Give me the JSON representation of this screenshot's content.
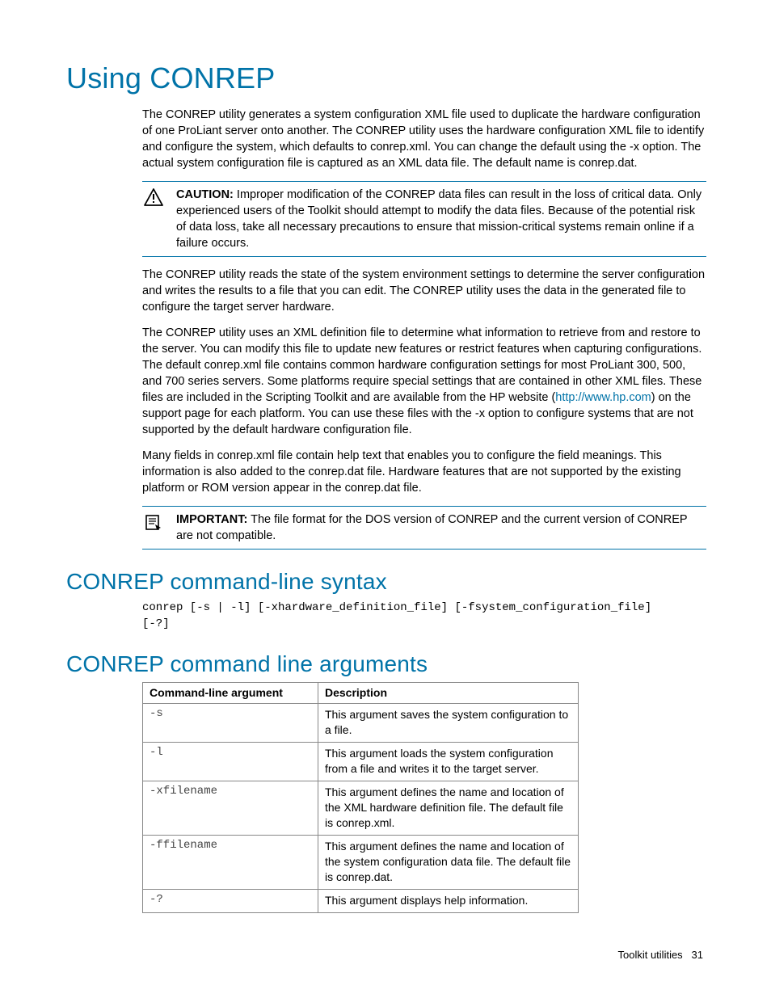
{
  "title": "Using CONREP",
  "intro": "The CONREP utility generates a system configuration XML file used to duplicate the hardware configuration of one ProLiant server onto another. The CONREP utility uses the hardware configuration XML file to identify and configure the system, which defaults to conrep.xml. You can change the default using the -x option. The actual system configuration file is captured as an XML data file. The default name is conrep.dat.",
  "caution": {
    "label": "CAUTION:",
    "text": "Improper modification of the CONREP data files can result in the loss of critical data. Only experienced users of the Toolkit should attempt to modify the data files. Because of the potential risk of data loss, take all necessary precautions to ensure that mission-critical systems remain online if a failure occurs."
  },
  "para2": "The CONREP utility reads the state of the system environment settings to determine the server configuration and writes the results to a file that you can edit. The CONREP utility uses the data in the generated file to configure the target server hardware.",
  "para3_pre": "The CONREP utility uses an XML definition file to determine what information to retrieve from and restore to the server. You can modify this file to update new features or restrict features when capturing configurations. The default conrep.xml file contains common hardware configuration settings for most ProLiant 300, 500, and 700 series servers. Some platforms require special settings that are contained in other XML files. These files are included in the Scripting Toolkit and are available from the HP website (",
  "para3_link_text": "http://www.hp.com",
  "para3_post": ") on the support page for each platform. You can use these files with the -x option to configure systems that are not supported by the default hardware configuration file.",
  "para4": "Many fields in conrep.xml file contain help text that enables you to configure the field meanings. This information is also added to the conrep.dat file. Hardware features that are not supported by the existing platform or ROM version appear in the conrep.dat file.",
  "important": {
    "label": "IMPORTANT:",
    "text": "The file format for the DOS version of CONREP and the current version of CONREP are not compatible."
  },
  "syntax_heading": "CONREP command-line syntax",
  "syntax_code": "conrep [-s | -l] [-xhardware_definition_file] [-fsystem_configuration_file]\n[-?]",
  "args_heading": "CONREP command line arguments",
  "table": {
    "headers": {
      "arg": "Command-line argument",
      "desc": "Description"
    },
    "rows": [
      {
        "arg": "-s",
        "desc": "This argument saves the system configuration to a file."
      },
      {
        "arg": "-l",
        "desc": "This argument loads the system configuration from a file and writes it to the target server."
      },
      {
        "arg": "-xfilename",
        "desc": "This argument defines the name and location of the XML hardware definition file. The default file is conrep.xml."
      },
      {
        "arg": "-ffilename",
        "desc": "This argument defines the name and location of the system configuration data file. The default file is conrep.dat."
      },
      {
        "arg": "-?",
        "desc": "This argument displays help information."
      }
    ]
  },
  "footer": {
    "section": "Toolkit utilities",
    "page": "31"
  }
}
